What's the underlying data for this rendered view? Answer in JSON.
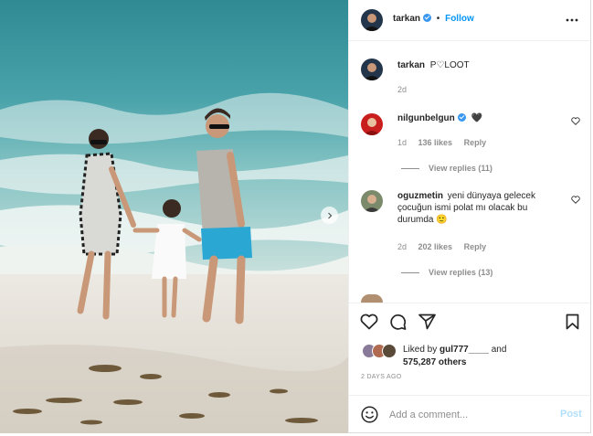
{
  "post": {
    "author": "tarkan",
    "follow_sep": "•",
    "follow_label": "Follow",
    "more_icon": "more-horizontal-icon",
    "caption_text": "P♡LOOT",
    "caption_age": "2d"
  },
  "comments": [
    {
      "username": "nilgunbelgun",
      "verified": true,
      "text": "🖤",
      "age": "1d",
      "likes": "136 likes",
      "reply_label": "Reply",
      "view_replies": "View replies (11)"
    },
    {
      "username": "oguzmetin",
      "verified": false,
      "text_lines": [
        "yeni dünyaya gelecek",
        "çocuğun ismi polat mı olacak bu",
        "durumda 🙂"
      ],
      "age": "2d",
      "likes": "202 likes",
      "reply_label": "Reply",
      "view_replies": "View replies (13)"
    }
  ],
  "actions": {
    "like_icon": "heart-icon",
    "comment_icon": "comment-icon",
    "share_icon": "share-icon",
    "save_icon": "bookmark-icon"
  },
  "likes": {
    "prefix": "Liked by",
    "user": "gul777____",
    "conj": "and",
    "count": "575,287 others"
  },
  "timestamp": "2 DAYS AGO",
  "add_comment": {
    "placeholder": "Add a comment...",
    "post_label": "Post"
  },
  "colors": {
    "accent": "#0095f6",
    "verified": "#3897f0",
    "post_disabled": "#b2dffc",
    "muted": "#8e8e8e"
  }
}
